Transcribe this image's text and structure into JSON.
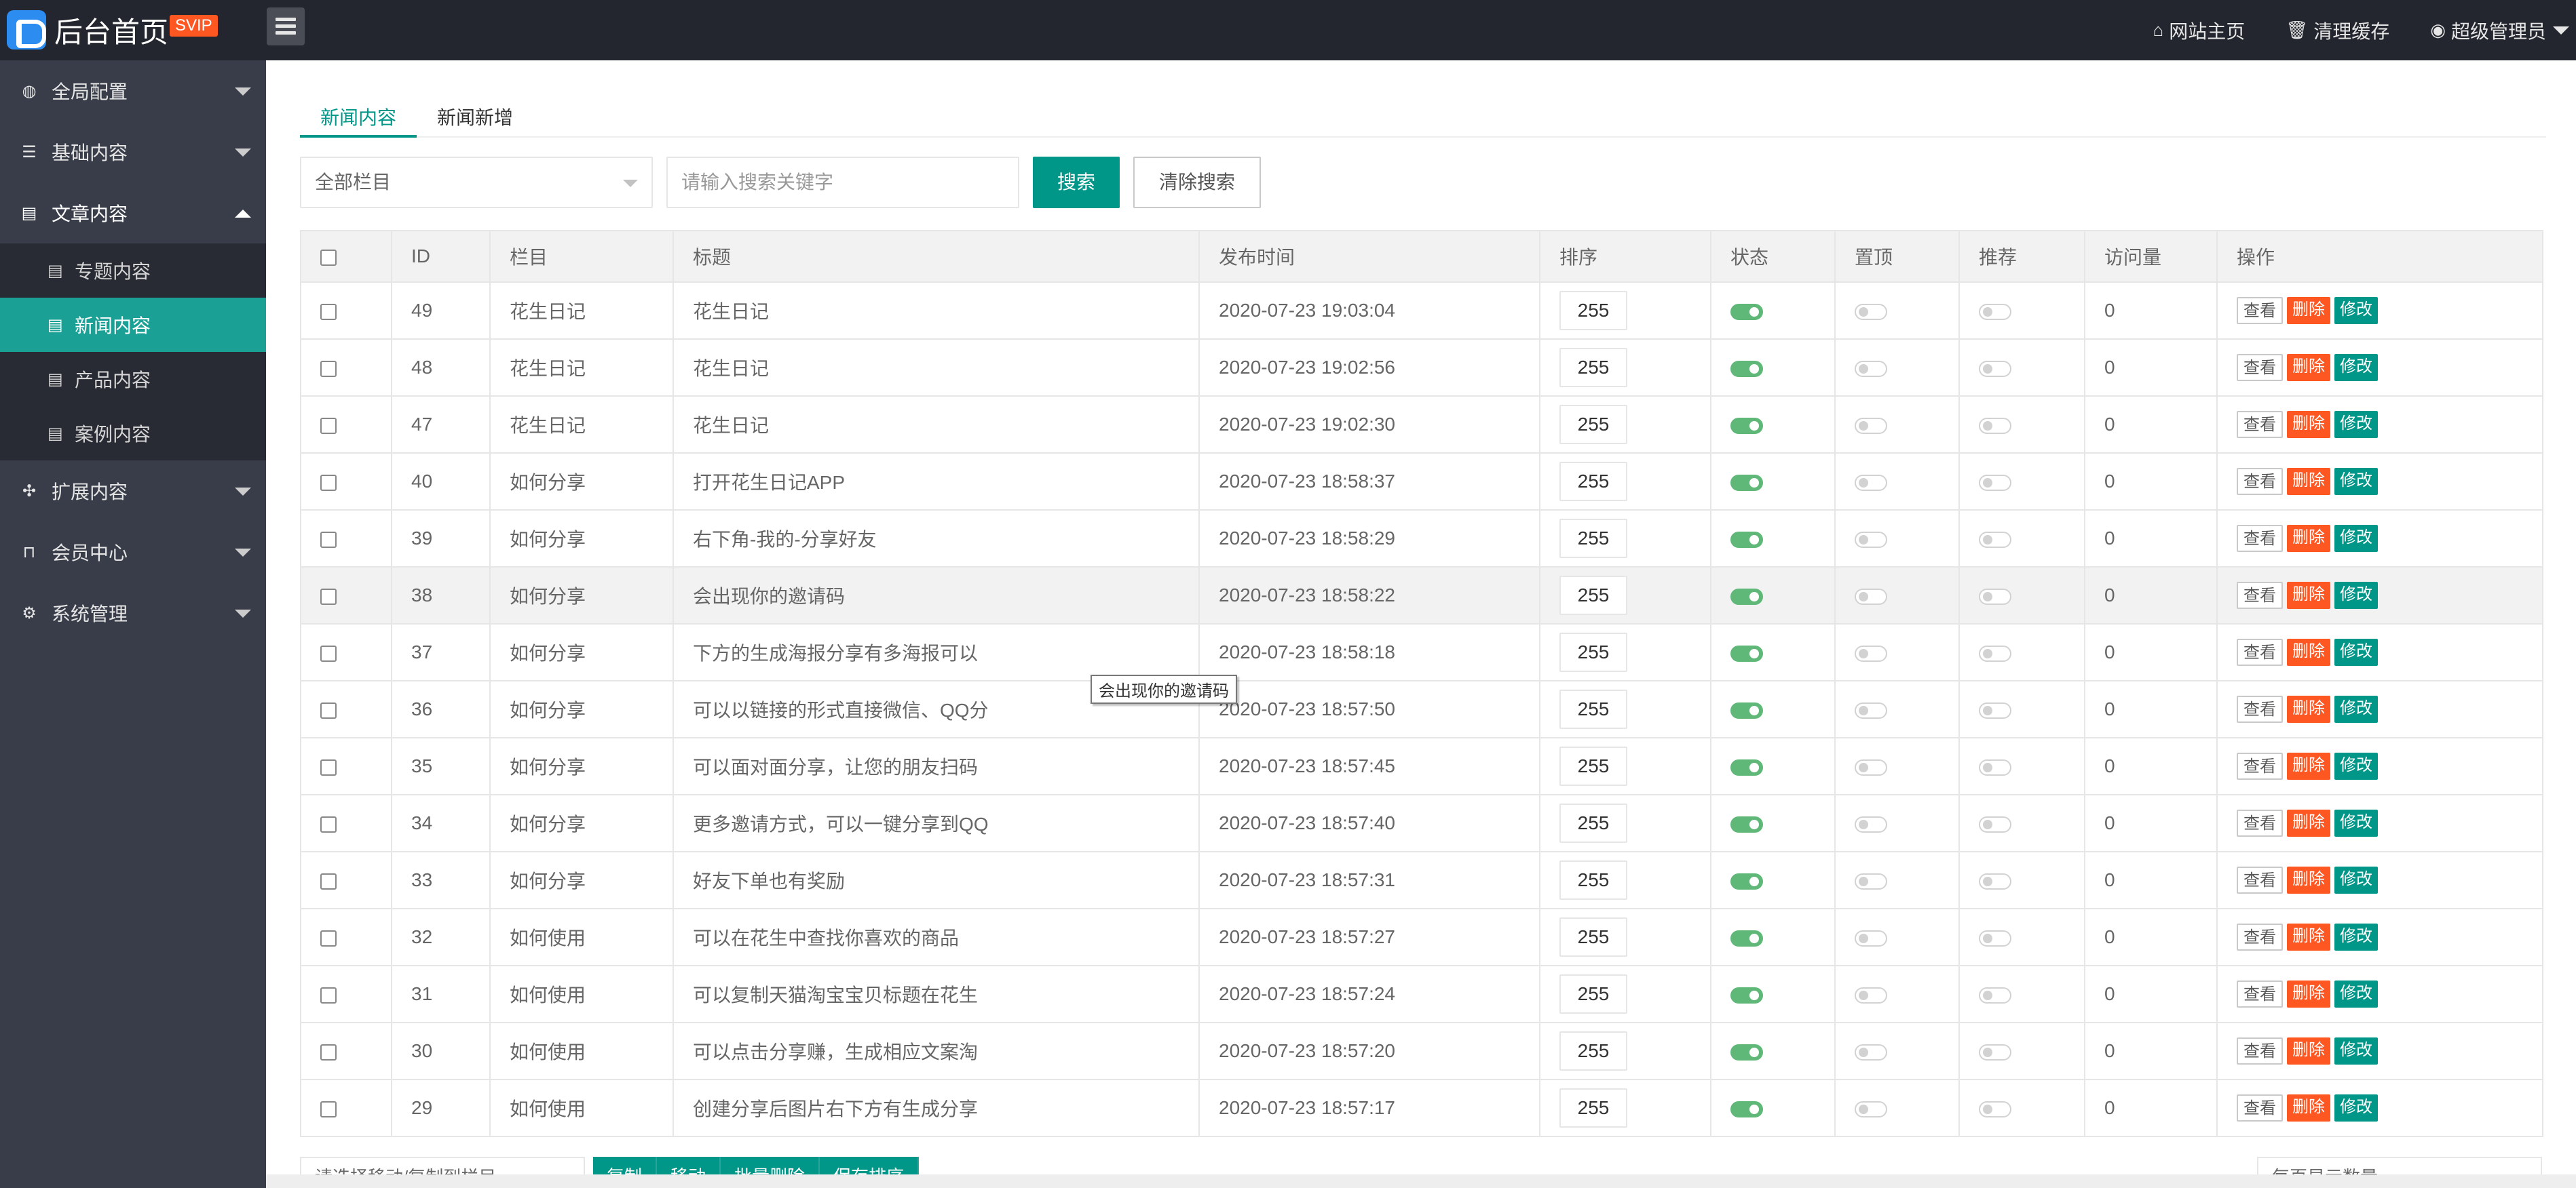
{
  "header": {
    "title": "后台首页",
    "badge": "SVIP",
    "links": [
      {
        "icon": "home-icon",
        "label": "网站主页"
      },
      {
        "icon": "trash-icon",
        "label": "清理缓存"
      },
      {
        "icon": "user-icon",
        "label": "超级管理员"
      }
    ]
  },
  "sidebar": {
    "items": [
      {
        "icon": "globe-icon",
        "label": "全局配置"
      },
      {
        "icon": "sliders-icon",
        "label": "基础内容"
      },
      {
        "icon": "file-icon",
        "label": "文章内容"
      },
      {
        "icon": "puzzle-icon",
        "label": "扩展内容"
      },
      {
        "icon": "lock-icon",
        "label": "会员中心"
      },
      {
        "icon": "gear-icon",
        "label": "系统管理"
      }
    ],
    "subitems": [
      {
        "label": "专题内容"
      },
      {
        "label": "新闻内容"
      },
      {
        "label": "产品内容"
      },
      {
        "label": "案例内容"
      }
    ]
  },
  "tabs": [
    "新闻内容",
    "新闻新增"
  ],
  "filters": {
    "category": "全部栏目",
    "keyword_placeholder": "请输入搜索关键字",
    "search_label": "搜索",
    "clear_label": "清除搜索"
  },
  "table": {
    "columns": [
      "ID",
      "栏目",
      "标题",
      "发布时间",
      "排序",
      "状态",
      "置顶",
      "推荐",
      "访问量",
      "操作"
    ],
    "action_labels": {
      "view": "查看",
      "delete": "删除",
      "edit": "修改"
    },
    "rows": [
      {
        "id": "49",
        "category": "花生日记",
        "title": "花生日记",
        "time": "2020-07-23 19:03:04",
        "sort": "255",
        "status": true,
        "top": false,
        "recommend": false,
        "views": "0"
      },
      {
        "id": "48",
        "category": "花生日记",
        "title": "花生日记",
        "time": "2020-07-23 19:02:56",
        "sort": "255",
        "status": true,
        "top": false,
        "recommend": false,
        "views": "0"
      },
      {
        "id": "47",
        "category": "花生日记",
        "title": "花生日记",
        "time": "2020-07-23 19:02:30",
        "sort": "255",
        "status": true,
        "top": false,
        "recommend": false,
        "views": "0"
      },
      {
        "id": "40",
        "category": "如何分享",
        "title": "打开花生日记APP",
        "time": "2020-07-23 18:58:37",
        "sort": "255",
        "status": true,
        "top": false,
        "recommend": false,
        "views": "0"
      },
      {
        "id": "39",
        "category": "如何分享",
        "title": "右下角-我的-分享好友",
        "time": "2020-07-23 18:58:29",
        "sort": "255",
        "status": true,
        "top": false,
        "recommend": false,
        "views": "0"
      },
      {
        "id": "38",
        "category": "如何分享",
        "title": "会出现你的邀请码",
        "time": "2020-07-23 18:58:22",
        "sort": "255",
        "status": true,
        "top": false,
        "recommend": false,
        "views": "0"
      },
      {
        "id": "37",
        "category": "如何分享",
        "title": "下方的生成海报分享有多海报可以",
        "time": "2020-07-23 18:58:18",
        "sort": "255",
        "status": true,
        "top": false,
        "recommend": false,
        "views": "0"
      },
      {
        "id": "36",
        "category": "如何分享",
        "title": "可以以链接的形式直接微信、QQ分",
        "time": "2020-07-23 18:57:50",
        "sort": "255",
        "status": true,
        "top": false,
        "recommend": false,
        "views": "0"
      },
      {
        "id": "35",
        "category": "如何分享",
        "title": "可以面对面分享，让您的朋友扫码",
        "time": "2020-07-23 18:57:45",
        "sort": "255",
        "status": true,
        "top": false,
        "recommend": false,
        "views": "0"
      },
      {
        "id": "34",
        "category": "如何分享",
        "title": "更多邀请方式，可以一键分享到QQ",
        "time": "2020-07-23 18:57:40",
        "sort": "255",
        "status": true,
        "top": false,
        "recommend": false,
        "views": "0"
      },
      {
        "id": "33",
        "category": "如何分享",
        "title": "好友下单也有奖励",
        "time": "2020-07-23 18:57:31",
        "sort": "255",
        "status": true,
        "top": false,
        "recommend": false,
        "views": "0"
      },
      {
        "id": "32",
        "category": "如何使用",
        "title": "可以在花生中查找你喜欢的商品",
        "time": "2020-07-23 18:57:27",
        "sort": "255",
        "status": true,
        "top": false,
        "recommend": false,
        "views": "0"
      },
      {
        "id": "31",
        "category": "如何使用",
        "title": "可以复制天猫淘宝宝贝标题在花生",
        "time": "2020-07-23 18:57:24",
        "sort": "255",
        "status": true,
        "top": false,
        "recommend": false,
        "views": "0"
      },
      {
        "id": "30",
        "category": "如何使用",
        "title": "可以点击分享赚，生成相应文案淘",
        "time": "2020-07-23 18:57:20",
        "sort": "255",
        "status": true,
        "top": false,
        "recommend": false,
        "views": "0"
      },
      {
        "id": "29",
        "category": "如何使用",
        "title": "创建分享后图片右下方有生成分享",
        "time": "2020-07-23 18:57:17",
        "sort": "255",
        "status": true,
        "top": false,
        "recommend": false,
        "views": "0"
      }
    ]
  },
  "tooltip": "会出现你的邀请码",
  "bottom": {
    "move_select": "请选择移动/复制到栏目",
    "buttons": [
      "复制",
      "移动",
      "批量删除",
      "保存排序"
    ],
    "page_size": "每页显示数量"
  },
  "colors": {
    "accent": "#009688",
    "danger": "#ff5722",
    "switch_on": "#5fb878",
    "header_bg": "#23262e",
    "sidebar_bg": "#393d49"
  }
}
